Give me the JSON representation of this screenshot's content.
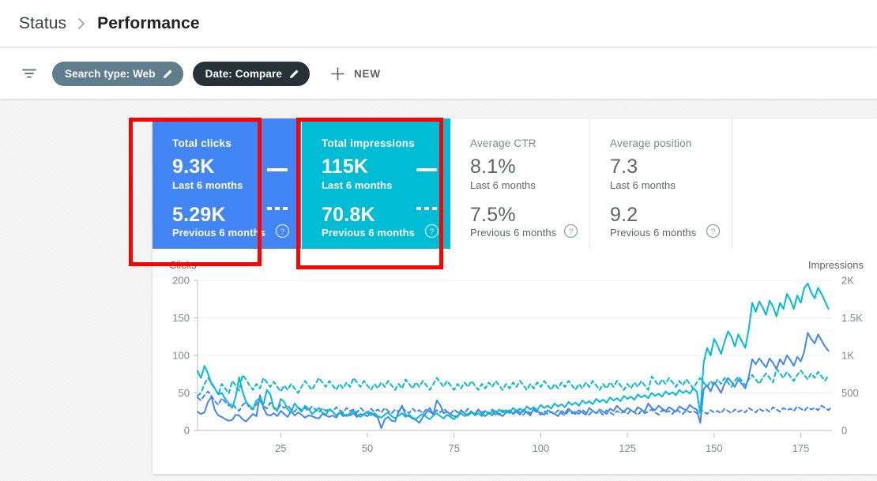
{
  "breadcrumb": {
    "parent": "Status",
    "separator_icon": "chevron-right-icon",
    "current": "Performance"
  },
  "filter_bar": {
    "filter_icon": "filter-list-icon",
    "chips": [
      {
        "label": "Search type: Web",
        "edit_icon": "pencil-icon",
        "color": "#5f7d8c"
      },
      {
        "label": "Date: Compare",
        "edit_icon": "pencil-icon",
        "color": "#263238"
      }
    ],
    "new_button": {
      "plus_icon": "plus-icon",
      "label": "NEW"
    }
  },
  "metric_cards": [
    {
      "title": "Total clicks",
      "current_value": "9.3K",
      "current_label": "Last 6 months",
      "previous_value": "5.29K",
      "previous_label": "Previous 6 months",
      "color": "#4285f4",
      "selected": true,
      "help_icon": "help-circle-icon"
    },
    {
      "title": "Total impressions",
      "current_value": "115K",
      "current_label": "Last 6 months",
      "previous_value": "70.8K",
      "previous_label": "Previous 6 months",
      "color": "#00bcd4",
      "selected": true,
      "help_icon": "help-circle-icon"
    },
    {
      "title": "Average CTR",
      "current_value": "8.1%",
      "current_label": "Last 6 months",
      "previous_value": "7.5%",
      "previous_label": "Previous 6 months",
      "color": "#ffffff",
      "selected": false,
      "help_icon": "help-circle-icon"
    },
    {
      "title": "Average position",
      "current_value": "7.3",
      "current_label": "Last 6 months",
      "previous_value": "9.2",
      "previous_label": "Previous 6 months",
      "color": "#ffffff",
      "selected": false,
      "help_icon": "help-circle-icon"
    }
  ],
  "annotations": [
    {
      "name": "clicks-card-highlight",
      "color": "#ff0000"
    },
    {
      "name": "impressions-card-highlight",
      "color": "#ff0000"
    }
  ],
  "chart_data": {
    "type": "line",
    "title": "",
    "xlabel": "",
    "ylabel": "Clicks",
    "y2label": "Impressions",
    "ylim": [
      0,
      200
    ],
    "y2lim": [
      0,
      2000
    ],
    "xlim": [
      1,
      184
    ],
    "grid": true,
    "legend_position": "none",
    "yticks": [
      0,
      50,
      100,
      150,
      200
    ],
    "ytick_labels": [
      "0",
      "50",
      "100",
      "150",
      "200"
    ],
    "y2ticks": [
      0,
      500,
      1000,
      1500,
      2000
    ],
    "y2tick_labels": [
      "0",
      "500",
      "1K",
      "1.5K",
      "2K"
    ],
    "xticks": [
      25,
      50,
      75,
      100,
      125,
      150,
      175
    ],
    "xtick_labels": [
      "25",
      "50",
      "75",
      "100",
      "125",
      "150",
      "175"
    ],
    "series": [
      {
        "name": "Clicks (Last 6 months)",
        "axis": "left",
        "color": "#4285f4",
        "style": "solid",
        "values": [
          25,
          22,
          24,
          38,
          45,
          27,
          20,
          18,
          15,
          13,
          14,
          21,
          20,
          15,
          12,
          17,
          22,
          19,
          47,
          30,
          21,
          20,
          23,
          19,
          26,
          22,
          18,
          26,
          20,
          24,
          21,
          17,
          20,
          19,
          17,
          16,
          22,
          20,
          18,
          20,
          17,
          24,
          19,
          21,
          20,
          23,
          18,
          22,
          21,
          19,
          24,
          20,
          17,
          3,
          15,
          18,
          13,
          12,
          25,
          33,
          21,
          19,
          16,
          14,
          10,
          18,
          24,
          30,
          21,
          40,
          34,
          23,
          25,
          21,
          19,
          18,
          27,
          23,
          20,
          24,
          21,
          28,
          22,
          19,
          24,
          20,
          26,
          22,
          19,
          24,
          27,
          22,
          25,
          21,
          28,
          24,
          20,
          29,
          26,
          23,
          21,
          27,
          24,
          22,
          19,
          26,
          23,
          29,
          25,
          22,
          27,
          24,
          21,
          30,
          26,
          23,
          28,
          25,
          22,
          29,
          26,
          33,
          28,
          25,
          30,
          27,
          24,
          31,
          28,
          25,
          36,
          30,
          27,
          33,
          29,
          26,
          31,
          28,
          25,
          32,
          29,
          27,
          34,
          30,
          28,
          10,
          55,
          60,
          52,
          64,
          58,
          50,
          62,
          70,
          65,
          58,
          68,
          62,
          56,
          72,
          95,
          88,
          96,
          90,
          84,
          96,
          90,
          82,
          95,
          88,
          100,
          94,
          86,
          98,
          92,
          105,
          130,
          122,
          116,
          128,
          120,
          112,
          106
        ]
      },
      {
        "name": "Clicks (Previous 6 months)",
        "axis": "left",
        "color": "#4285f4",
        "style": "dashed",
        "values": [
          44,
          40,
          47,
          52,
          46,
          39,
          34,
          43,
          38,
          33,
          36,
          30,
          26,
          34,
          38,
          30,
          28,
          35,
          40,
          33,
          29,
          37,
          31,
          28,
          34,
          30,
          33,
          28,
          25,
          31,
          27,
          30,
          26,
          32,
          28,
          24,
          30,
          26,
          29,
          25,
          31,
          27,
          24,
          30,
          26,
          28,
          24,
          30,
          26,
          23,
          29,
          25,
          28,
          24,
          30,
          26,
          23,
          28,
          25,
          30,
          26,
          23,
          29,
          25,
          27,
          23,
          28,
          25,
          22,
          27,
          24,
          29,
          25,
          22,
          28,
          24,
          27,
          23,
          29,
          25,
          22,
          28,
          24,
          26,
          22,
          28,
          24,
          21,
          27,
          23,
          26,
          22,
          28,
          24,
          21,
          26,
          23,
          27,
          24,
          21,
          26,
          22,
          25,
          22,
          27,
          23,
          20,
          26,
          23,
          25,
          22,
          27,
          24,
          21,
          26,
          23,
          25,
          21,
          27,
          24,
          21,
          26,
          23,
          25,
          22,
          27,
          24,
          21,
          26,
          23,
          25,
          28,
          24,
          21,
          27,
          24,
          26,
          22,
          28,
          25,
          22,
          27,
          24,
          26,
          23,
          28,
          25,
          22,
          27,
          24,
          26,
          23,
          29,
          26,
          23,
          28,
          25,
          27,
          24,
          30,
          27,
          24,
          29,
          26,
          28,
          25,
          31,
          28,
          25,
          30,
          27,
          29,
          26,
          32,
          29,
          26,
          31,
          28,
          30,
          27,
          33,
          30,
          27,
          32
        ]
      },
      {
        "name": "Impressions (Last 6 months)",
        "axis": "right",
        "color": "#00bcd4",
        "style": "solid",
        "values": [
          790,
          700,
          860,
          760,
          620,
          560,
          480,
          500,
          420,
          360,
          300,
          450,
          710,
          520,
          380,
          330,
          280,
          400,
          430,
          350,
          540,
          480,
          300,
          260,
          420,
          380,
          280,
          240,
          360,
          300,
          250,
          330,
          290,
          220,
          260,
          300,
          240,
          210,
          280,
          250,
          200,
          240,
          220,
          190,
          230,
          260,
          210,
          180,
          220,
          250,
          200,
          230,
          190,
          170,
          210,
          240,
          190,
          160,
          200,
          230,
          180,
          210,
          170,
          150,
          190,
          220,
          180,
          150,
          200,
          230,
          190,
          160,
          210,
          180,
          150,
          200,
          230,
          190,
          220,
          250,
          200,
          230,
          190,
          260,
          220,
          250,
          210,
          280,
          240,
          270,
          230,
          300,
          260,
          290,
          250,
          320,
          280,
          310,
          270,
          340,
          300,
          330,
          290,
          360,
          320,
          350,
          310,
          380,
          340,
          370,
          330,
          400,
          360,
          390,
          350,
          420,
          380,
          410,
          370,
          440,
          400,
          430,
          390,
          460,
          420,
          450,
          410,
          480,
          440,
          470,
          430,
          500,
          460,
          490,
          450,
          520,
          480,
          510,
          470,
          540,
          500,
          530,
          490,
          560,
          520,
          230,
          900,
          1100,
          1000,
          1220,
          1130,
          1020,
          1180,
          1320,
          1250,
          1120,
          1280,
          1190,
          1100,
          1350,
          1700,
          1580,
          1720,
          1640,
          1540,
          1730,
          1650,
          1520,
          1700,
          1620,
          1820,
          1740,
          1620,
          1800,
          1700,
          1900,
          1960,
          1840,
          1760,
          1900,
          1820,
          1720,
          1620
        ]
      },
      {
        "name": "Impressions (Previous 6 months)",
        "axis": "right",
        "color": "#00bcd4",
        "style": "dashed",
        "values": [
          460,
          500,
          620,
          700,
          640,
          560,
          480,
          620,
          560,
          490,
          660,
          600,
          530,
          740,
          680,
          600,
          540,
          620,
          560,
          700,
          640,
          580,
          650,
          580,
          520,
          600,
          540,
          620,
          560,
          500,
          580,
          660,
          600,
          540,
          620,
          700,
          640,
          580,
          660,
          600,
          540,
          620,
          560,
          640,
          580,
          700,
          640,
          580,
          660,
          600,
          540,
          620,
          560,
          640,
          580,
          660,
          600,
          540,
          620,
          560,
          680,
          620,
          560,
          640,
          580,
          660,
          600,
          540,
          620,
          700,
          640,
          580,
          660,
          600,
          540,
          620,
          560,
          640,
          580,
          660,
          600,
          540,
          620,
          560,
          640,
          580,
          660,
          600,
          540,
          620,
          560,
          640,
          580,
          660,
          600,
          540,
          620,
          560,
          640,
          580,
          660,
          600,
          540,
          620,
          560,
          640,
          580,
          660,
          600,
          540,
          620,
          560,
          640,
          580,
          660,
          600,
          540,
          620,
          560,
          640,
          580,
          660,
          600,
          540,
          620,
          560,
          640,
          580,
          660,
          600,
          540,
          720,
          660,
          600,
          680,
          620,
          700,
          640,
          580,
          660,
          600,
          680,
          620,
          560,
          640,
          700,
          640,
          580,
          660,
          600,
          680,
          620,
          700,
          640,
          580,
          660,
          720,
          660,
          600,
          680,
          740,
          680,
          620,
          700,
          760,
          700,
          640,
          820,
          760,
          700,
          780,
          720,
          660,
          740,
          800,
          740,
          680,
          760,
          700,
          780,
          720,
          660,
          740
        ]
      }
    ]
  }
}
